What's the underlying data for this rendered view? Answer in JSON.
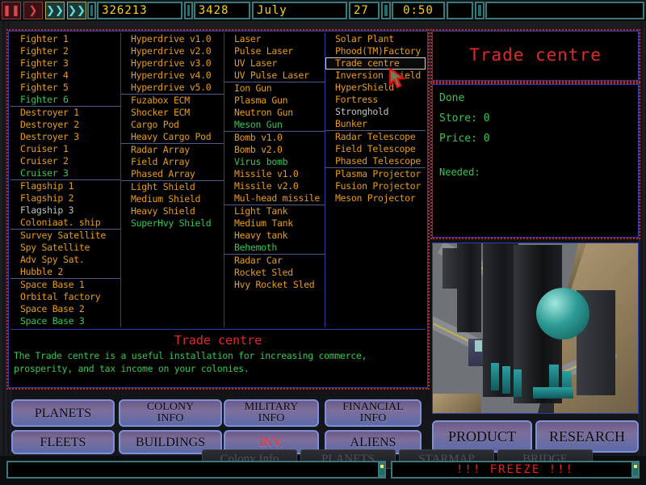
{
  "topbar": {
    "controls": [
      {
        "name": "pause-button",
        "glyph": "❚❚",
        "style": "red"
      },
      {
        "name": "play-button",
        "glyph": "❯",
        "style": "red"
      },
      {
        "name": "fast-forward-button",
        "glyph": "❯❯",
        "style": "teal"
      },
      {
        "name": "ultra-speed-button",
        "glyph": "❯❯",
        "style": "teal"
      }
    ],
    "credits": "326213",
    "year": "3428",
    "month": "July",
    "day": "27",
    "time": "0:50"
  },
  "columns": [
    {
      "name": "ships-column",
      "groups": [
        {
          "items": [
            {
              "label": "Fighter 1",
              "state": "known"
            },
            {
              "label": "Fighter 2",
              "state": "known"
            },
            {
              "label": "Fighter 3",
              "state": "known"
            },
            {
              "label": "Fighter 4",
              "state": "known"
            },
            {
              "label": "Fighter 5",
              "state": "known"
            },
            {
              "label": "Fighter 6",
              "state": "available"
            }
          ]
        },
        {
          "items": [
            {
              "label": "Destroyer 1",
              "state": "known"
            },
            {
              "label": "Destroyer 2",
              "state": "known"
            },
            {
              "label": "Destroyer 3",
              "state": "known"
            },
            {
              "label": "Cruiser 1",
              "state": "known"
            },
            {
              "label": "Cruiser 2",
              "state": "known"
            },
            {
              "label": "Cruiser 3",
              "state": "available"
            }
          ]
        },
        {
          "items": [
            {
              "label": "Flagship 1",
              "state": "known"
            },
            {
              "label": "Flagship 2",
              "state": "known"
            },
            {
              "label": "Flagship 3",
              "state": "disabled"
            },
            {
              "label": "Coloniaat. ship",
              "state": "known"
            }
          ]
        },
        {
          "items": [
            {
              "label": "Survey Satellite",
              "state": "known"
            },
            {
              "label": "Spy Satellite",
              "state": "known"
            },
            {
              "label": "Adv Spy Sat.",
              "state": "known"
            },
            {
              "label": "Hubble 2",
              "state": "known"
            }
          ]
        },
        {
          "items": [
            {
              "label": "Space Base 1",
              "state": "known"
            },
            {
              "label": "Orbital factory",
              "state": "known"
            },
            {
              "label": "Space Base 2",
              "state": "known"
            },
            {
              "label": "Space Base 3",
              "state": "available"
            }
          ]
        }
      ]
    },
    {
      "name": "drives-column",
      "groups": [
        {
          "items": [
            {
              "label": "Hyperdrive v1.0",
              "state": "known"
            },
            {
              "label": "Hyperdrive v2.0",
              "state": "known"
            },
            {
              "label": "Hyperdrive v3.0",
              "state": "known"
            },
            {
              "label": "Hyperdrive v4.0",
              "state": "known"
            },
            {
              "label": "Hyperdrive v5.0",
              "state": "known"
            }
          ]
        },
        {
          "items": [
            {
              "label": "Fuzabox ECM",
              "state": "known"
            },
            {
              "label": "Shocker ECM",
              "state": "known"
            },
            {
              "label": "Cargo Pod",
              "state": "known"
            },
            {
              "label": "Heavy Cargo Pod",
              "state": "known"
            }
          ]
        },
        {
          "items": [
            {
              "label": "Radar Array",
              "state": "known"
            },
            {
              "label": "Field Array",
              "state": "known"
            },
            {
              "label": "Phased Array",
              "state": "known"
            }
          ]
        },
        {
          "items": [
            {
              "label": "Light Shield",
              "state": "known"
            },
            {
              "label": "Medium Shield",
              "state": "known"
            },
            {
              "label": "Heavy Shield",
              "state": "known"
            },
            {
              "label": "SuperHvy Shield",
              "state": "available"
            }
          ]
        }
      ]
    },
    {
      "name": "weapons-column",
      "groups": [
        {
          "items": [
            {
              "label": "Laser",
              "state": "known"
            },
            {
              "label": "Pulse Laser",
              "state": "known"
            },
            {
              "label": "UV Laser",
              "state": "known"
            },
            {
              "label": "UV Pulse Laser",
              "state": "known"
            }
          ]
        },
        {
          "items": [
            {
              "label": "Ion Gun",
              "state": "known"
            },
            {
              "label": "Plasma Gun",
              "state": "known"
            },
            {
              "label": "Neutron Gun",
              "state": "known"
            },
            {
              "label": "Meson Gun",
              "state": "available"
            }
          ]
        },
        {
          "items": [
            {
              "label": "Bomb v1.0",
              "state": "known"
            },
            {
              "label": "Bomb v2.0",
              "state": "known"
            },
            {
              "label": "Virus bomb",
              "state": "available"
            },
            {
              "label": "Missile v1.0",
              "state": "known"
            },
            {
              "label": "Missile v2.0",
              "state": "known"
            },
            {
              "label": "Mul-head missile",
              "state": "known"
            }
          ]
        },
        {
          "items": [
            {
              "label": "Light Tank",
              "state": "known"
            },
            {
              "label": "Medium Tank",
              "state": "known"
            },
            {
              "label": "Heavy tank",
              "state": "known"
            },
            {
              "label": "Behemoth",
              "state": "available"
            }
          ]
        },
        {
          "items": [
            {
              "label": "Radar Car",
              "state": "known"
            },
            {
              "label": "Rocket Sled",
              "state": "known"
            },
            {
              "label": "Hvy Rocket Sled",
              "state": "known"
            }
          ]
        }
      ]
    },
    {
      "name": "buildings-column",
      "groups": [
        {
          "items": [
            {
              "label": "Solar Plant",
              "state": "known"
            },
            {
              "label": "Phood(TM)Factory",
              "state": "known"
            },
            {
              "label": "Trade centre",
              "state": "known",
              "selected": true
            },
            {
              "label": "Inversion Shield",
              "state": "known"
            },
            {
              "label": "HyperShield",
              "state": "known"
            },
            {
              "label": "Fortress",
              "state": "known"
            },
            {
              "label": "Stronghold",
              "state": "disabled"
            },
            {
              "label": "Bunker",
              "state": "known"
            }
          ]
        },
        {
          "items": [
            {
              "label": "Radar Telescope",
              "state": "known"
            },
            {
              "label": "Field Telescope",
              "state": "known"
            },
            {
              "label": "Phased Telescope",
              "state": "known"
            }
          ]
        },
        {
          "items": [
            {
              "label": "Plasma Projector",
              "state": "known"
            },
            {
              "label": "Fusion Projector",
              "state": "known"
            },
            {
              "label": "Meson Projector",
              "state": "known"
            }
          ]
        }
      ]
    }
  ],
  "description": {
    "title": "Trade centre",
    "text": "The Trade centre is a useful installation for increasing commerce, prosperity, and tax income on your colonies."
  },
  "detail_panel": {
    "title": "Trade centre",
    "status": "Done",
    "store_label": "Store: 0",
    "price_label": "Price: 0",
    "needed_label": "Needed:"
  },
  "nav_buttons": [
    {
      "name": "planets-button",
      "label": "PLANETS",
      "lines": [
        "PLANETS"
      ],
      "active": false
    },
    {
      "name": "colony-info-button",
      "label": "COLONY INFO",
      "lines": [
        "COLONY",
        "INFO"
      ],
      "active": false
    },
    {
      "name": "military-info-button",
      "label": "MILITARY INFO",
      "lines": [
        "MILITARY",
        "INFO"
      ],
      "active": false
    },
    {
      "name": "financial-info-button",
      "label": "FINANCIAL INFO",
      "lines": [
        "FINANCIAL",
        "INFO"
      ],
      "active": false
    },
    {
      "name": "fleets-button",
      "label": "FLEETS",
      "lines": [
        "FLEETS"
      ],
      "active": false
    },
    {
      "name": "buildings-button",
      "label": "BUILDINGS",
      "lines": [
        "BUILDINGS"
      ],
      "active": false
    },
    {
      "name": "inventory-button",
      "label": "INV.",
      "lines": [
        "INV."
      ],
      "active": true
    },
    {
      "name": "aliens-button",
      "label": "ALIENS",
      "lines": [
        "ALIENS"
      ],
      "active": false
    }
  ],
  "side_buttons": [
    {
      "name": "product-button",
      "label": "PRODUCT"
    },
    {
      "name": "research-button",
      "label": "RESEARCH"
    }
  ],
  "hidden_row": [
    {
      "name": "colony-info-ghost-button",
      "label": "Colony Info"
    },
    {
      "name": "planets-ghost-button",
      "label": "PLANETS"
    },
    {
      "name": "starmap-ghost-button",
      "label": "STARMAP"
    },
    {
      "name": "bridge-ghost-button",
      "label": "BRIDGE"
    }
  ],
  "status": {
    "message": "",
    "freeze": "!!! FREEZE !!!"
  },
  "colors": {
    "known": "#e89c18",
    "available": "#34c752",
    "disabled": "#bfc3c7",
    "accent_red": "#e02a2a",
    "frame_blue": "#2b3ea8",
    "lcd_yellow": "#ffd21a"
  }
}
